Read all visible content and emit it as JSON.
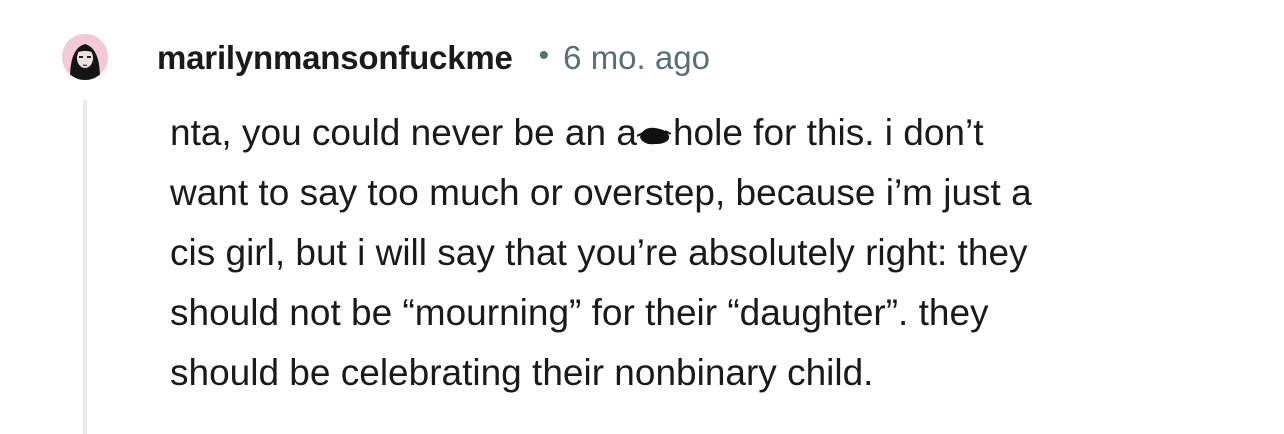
{
  "comment": {
    "username": "marilynmansonfuckme",
    "separator": "•",
    "timestamp": "6 mo. ago",
    "avatar_icon": "user-avatar-icon",
    "lines": [
      {
        "before_redaction": "nta, you could never be an a",
        "after_redaction": "hole for this. i don’t"
      },
      {
        "text": "want to say too much or overstep, because i’m just a"
      },
      {
        "text": "cis girl, but i will say that you’re absolutely right: they"
      },
      {
        "text": "should not be “mourning” for their “daughter”. they"
      },
      {
        "text": "should be celebrating their nonbinary child."
      }
    ]
  },
  "colors": {
    "text": "#1a1a1b",
    "meta": "#576f76",
    "thread_line": "#e5ebee",
    "avatar_bg": "#f3c9d6",
    "redaction": "#111111"
  }
}
